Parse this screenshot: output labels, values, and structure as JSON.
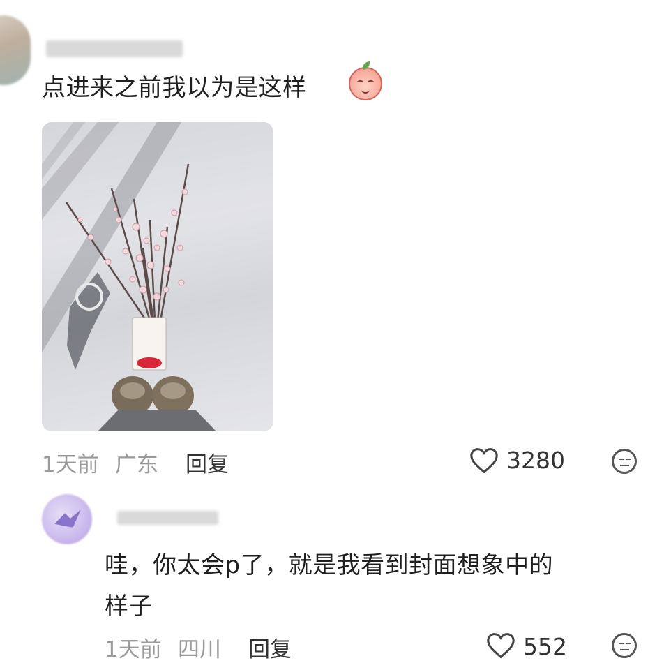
{
  "comments": [
    {
      "text": "点进来之前我以为是这样",
      "time": "1天前",
      "location": "广东",
      "reply_label": "回复",
      "likes": "3280"
    },
    {
      "text_line1": "哇，你太会p了，就是我看到封面想象中的",
      "text_line2": "样子",
      "time": "1天前",
      "location": "四川",
      "reply_label": "回复",
      "likes": "552"
    }
  ],
  "icons": {
    "like": "heart-outline-icon",
    "dislike": "neutral-face-icon",
    "emoji": "peach-sticker-icon"
  },
  "colors": {
    "meta_gray": "#9a9a9a",
    "text_dark": "#1f1f1f",
    "avatar2_purple": "#b59ee3"
  }
}
